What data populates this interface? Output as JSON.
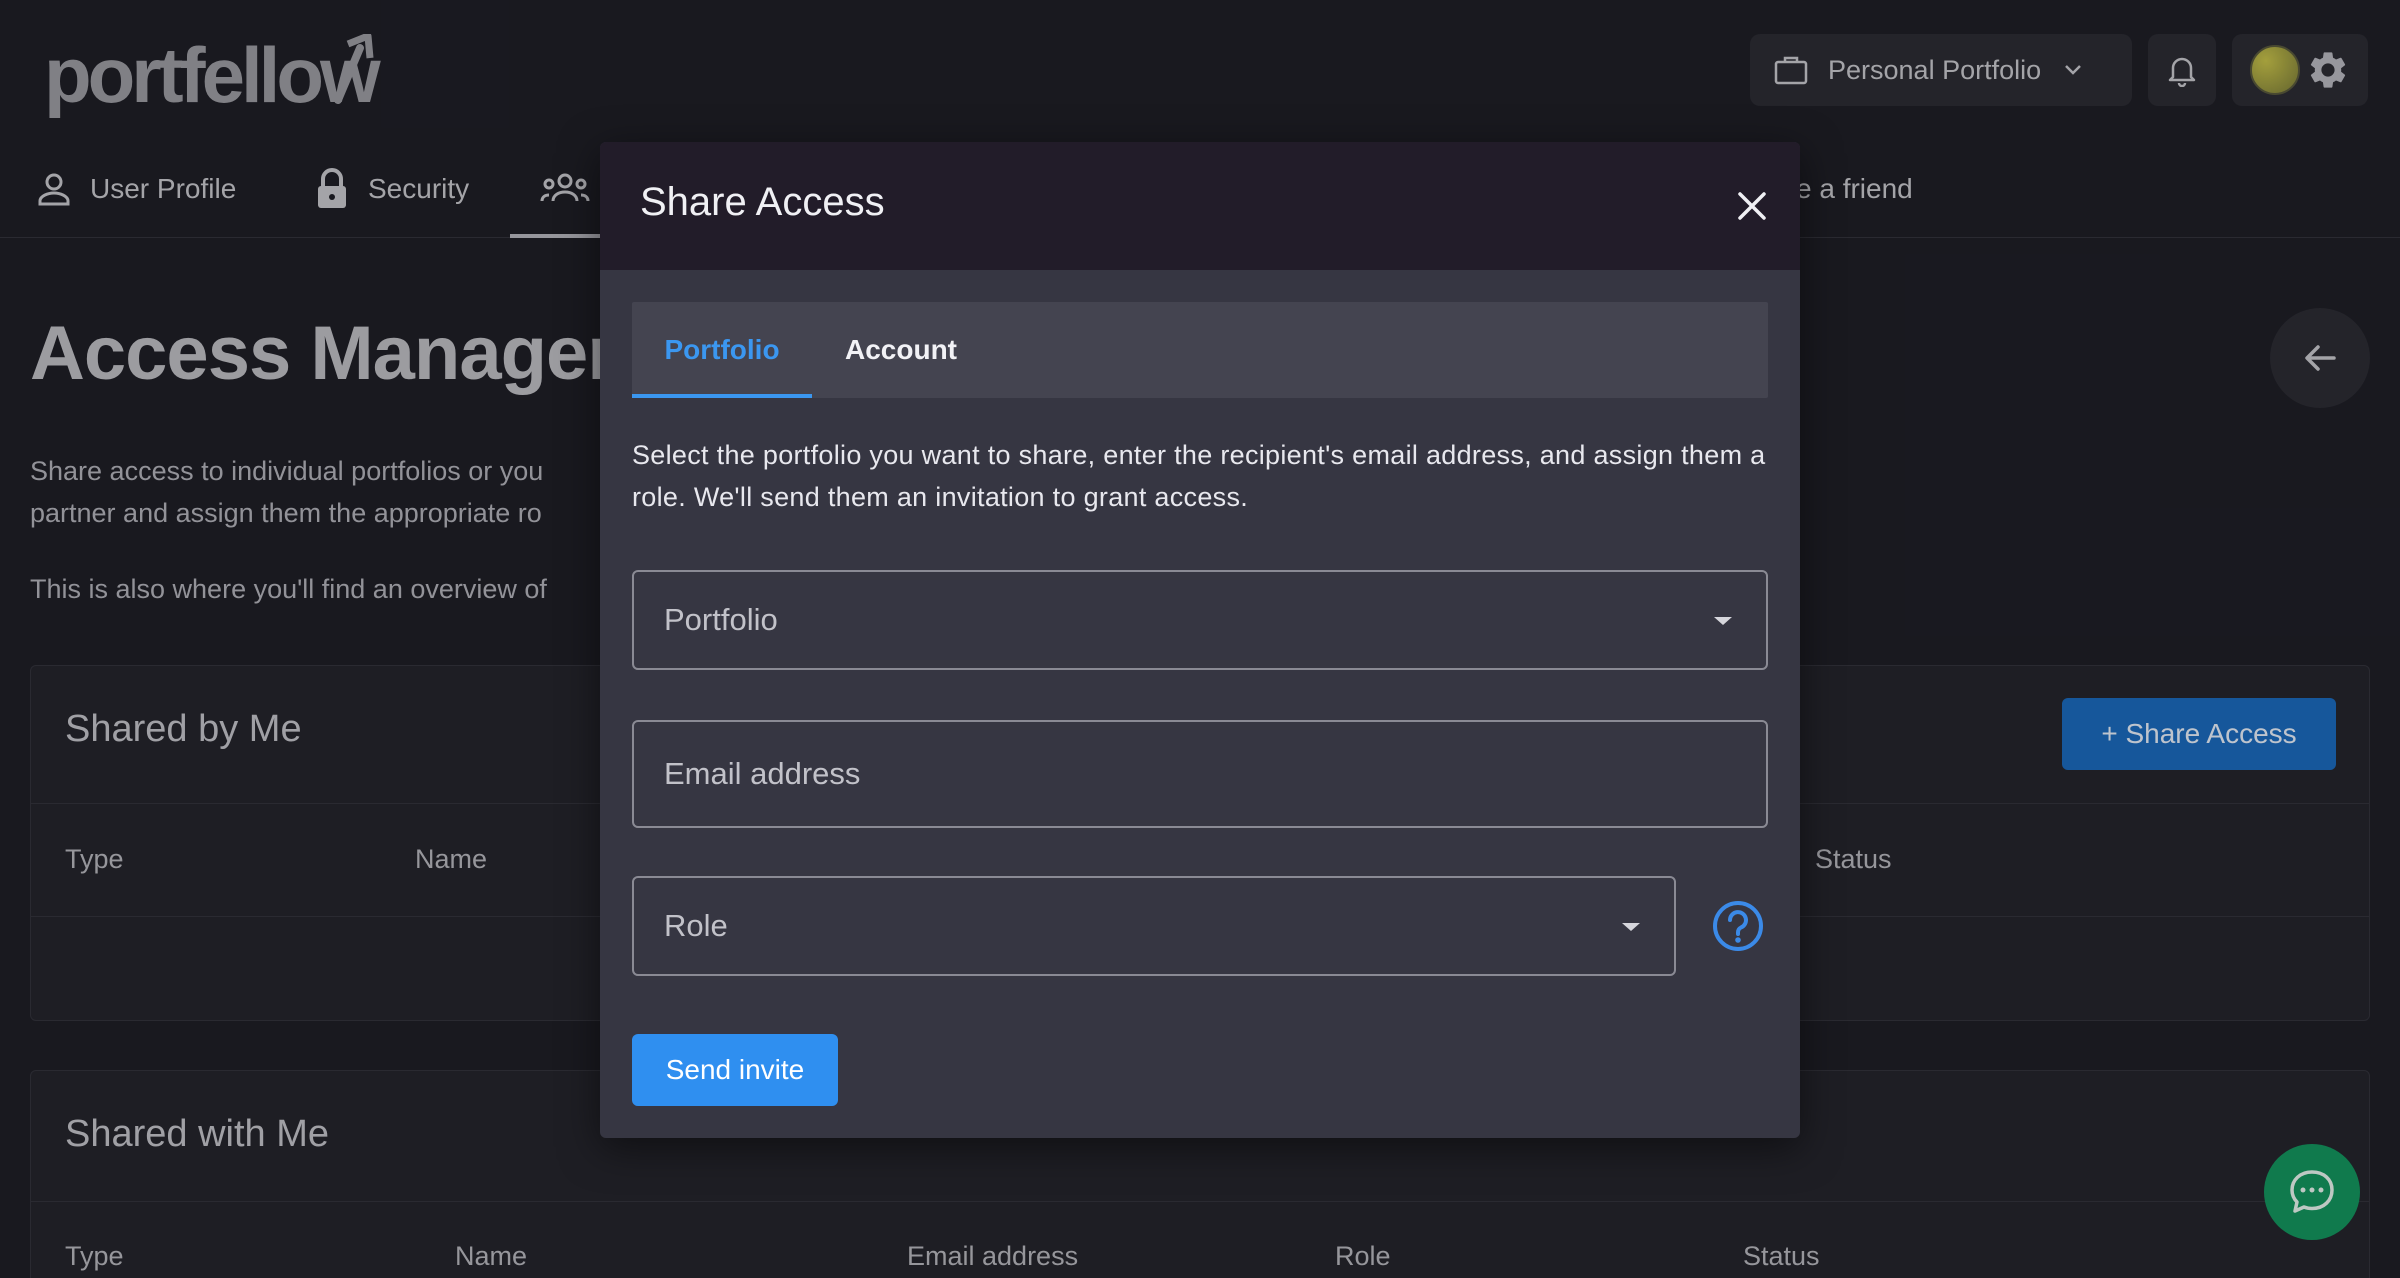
{
  "app": {
    "logo_text": "portfellow"
  },
  "header": {
    "portfolio_selector": "Personal Portfolio",
    "icons": [
      "briefcase-icon",
      "chevron-down-icon",
      "bell-icon",
      "avatar",
      "gear-icon"
    ]
  },
  "nav": {
    "items": [
      {
        "label": "User Profile",
        "icon": "user-icon"
      },
      {
        "label": "Security",
        "icon": "lock-icon"
      },
      {
        "label": "",
        "icon": "group-icon",
        "active": true
      },
      {
        "label": "e a friend",
        "icon": ""
      }
    ]
  },
  "page": {
    "title": "Access Manager",
    "desc_line1": "Share access to individual portfolios or you",
    "desc_line2": "partner and assign them the appropriate ro",
    "desc_line3": "This is also where you'll find an overview of"
  },
  "shared_by_me": {
    "title": "Shared by Me",
    "share_button": "+ Share Access",
    "columns": [
      "Type",
      "Name",
      "Status"
    ]
  },
  "shared_with_me": {
    "title": "Shared with Me",
    "columns": [
      "Type",
      "Name",
      "Email address",
      "Role",
      "Status"
    ]
  },
  "modal": {
    "title": "Share Access",
    "tabs": [
      {
        "label": "Portfolio",
        "active": true
      },
      {
        "label": "Account",
        "active": false
      }
    ],
    "description": "Select the portfolio you want to share, enter the recipient's email address, and assign them a role. We'll send them an invitation to grant access.",
    "portfolio_label": "Portfolio",
    "email_placeholder": "Email address",
    "role_label": "Role",
    "send_button": "Send invite"
  },
  "colors": {
    "accent": "#2f8ff0",
    "tab_active": "#3b97f0",
    "chat": "#14955f"
  }
}
